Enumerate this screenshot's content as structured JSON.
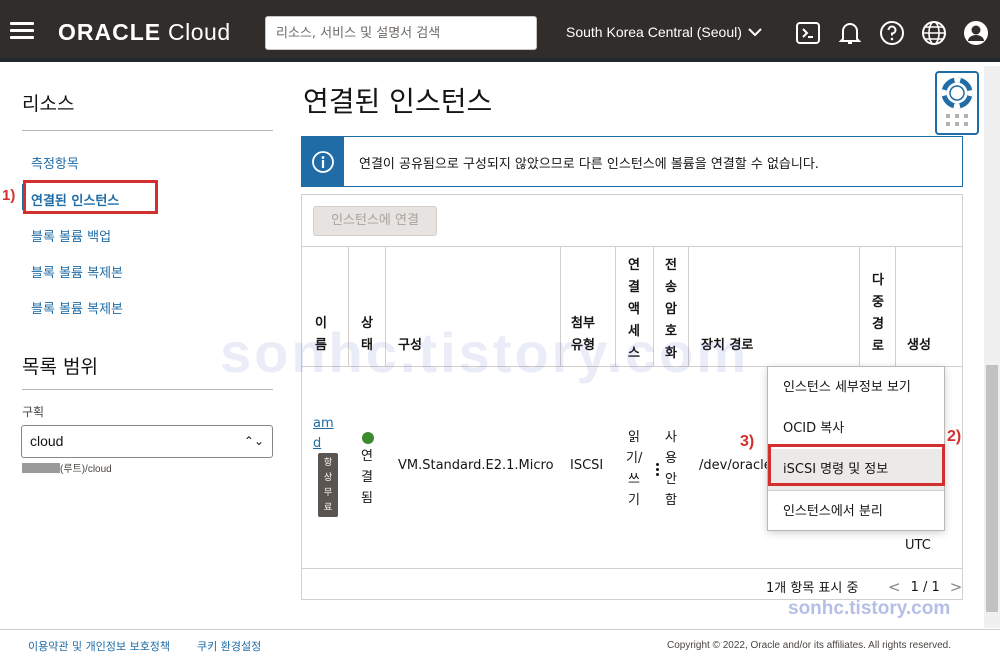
{
  "header": {
    "brand_bold": "ORACLE",
    "brand_light": "Cloud",
    "search_placeholder": "리소스, 서비스 및 설명서 검색",
    "region": "South Korea Central (Seoul)"
  },
  "sidebar": {
    "resources_title": "리소스",
    "items": [
      {
        "label": "측정항목"
      },
      {
        "label": "연결된 인스턴스"
      },
      {
        "label": "블록 볼륨 백업"
      },
      {
        "label": "블록 볼륨 복제본"
      },
      {
        "label": "블록 볼륨 복제본"
      }
    ],
    "scope_title": "목록 범위",
    "compartment_label": "구획",
    "compartment_value": "cloud",
    "compartment_path": "(루트)/cloud"
  },
  "main": {
    "title": "연결된 인스턴스",
    "info_message": "연결이 공유됨으로 구성되지 않았으므로 다른 인스턴스에 볼륨을 연결할 수 없습니다.",
    "attach_button": "인스턴스에 연결",
    "columns": {
      "name": [
        "이",
        "름"
      ],
      "state": [
        "상",
        "태"
      ],
      "shape": "구성",
      "attach_type": [
        "첨부",
        "유형"
      ],
      "access": [
        "연",
        "결",
        "액",
        "세",
        "스"
      ],
      "encryption": [
        "전",
        "송",
        "암",
        "호",
        "화"
      ],
      "device_path": "장치 경로",
      "multipath": [
        "다",
        "중",
        "경",
        "로"
      ],
      "created": "생성"
    },
    "row": {
      "name": [
        "am",
        "d"
      ],
      "badge": [
        "항",
        "상",
        "무",
        "료"
      ],
      "state": [
        "연",
        "결",
        "됨"
      ],
      "shape": "VM.Standard.E2.1.Micro",
      "attach_type": "ISCSI",
      "access": [
        "읽",
        "기/",
        "쓰",
        "기"
      ],
      "encryption": [
        "사",
        "용",
        "안",
        "함"
      ],
      "device_path": "/dev/oracle",
      "created_tail": "UTC"
    },
    "footer_count": "1개 항목 표시 중",
    "pager": "1 / 1"
  },
  "menu": {
    "items": [
      {
        "label": "인스턴스 세부정보 보기"
      },
      {
        "label": "OCID 복사"
      },
      {
        "label": "iSCSI 명령 및 정보"
      },
      {
        "label": "인스턴스에서 분리"
      }
    ]
  },
  "annotations": {
    "one": "1)",
    "two": "2)",
    "three": "3)",
    "color": "#d32f2f"
  },
  "watermark": "sonhc.tistory.com",
  "footer": {
    "terms": "이용약관 및 개인정보 보호정책",
    "cookies": "쿠키 환경설정",
    "copyright": "Copyright © 2022, Oracle and/or its affiliates. All rights reserved."
  }
}
